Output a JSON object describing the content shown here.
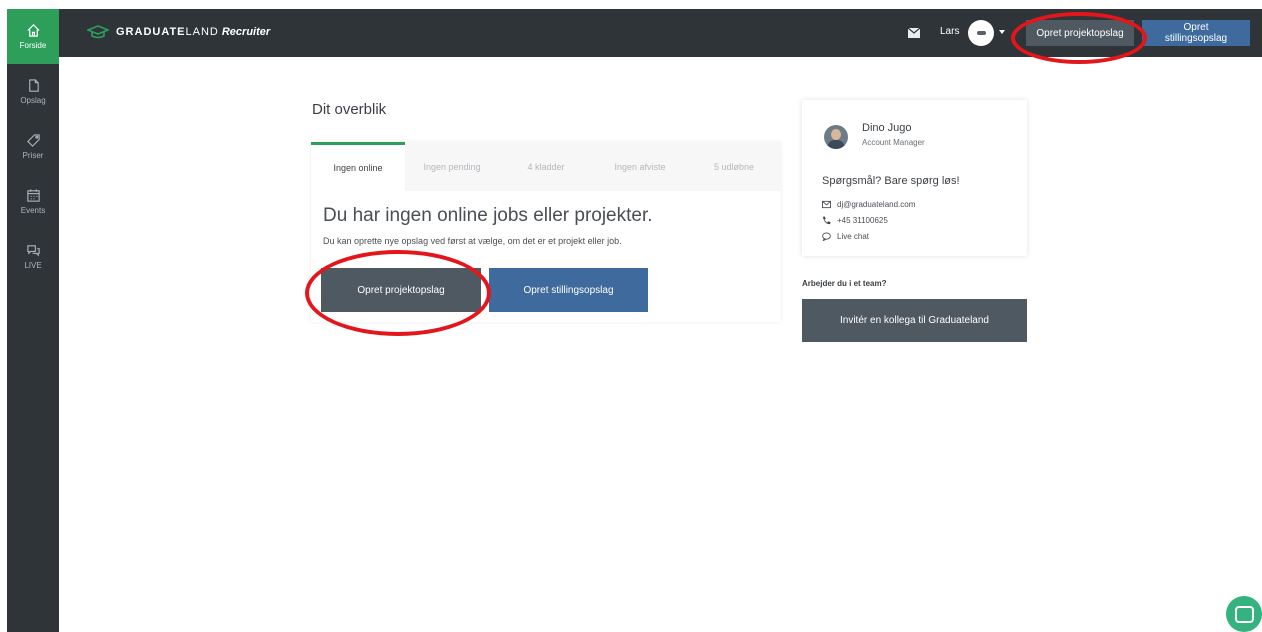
{
  "sidebar": {
    "items": [
      {
        "label": "Forside",
        "icon": "home-icon"
      },
      {
        "label": "Opslag",
        "icon": "document-icon"
      },
      {
        "label": "Priser",
        "icon": "tag-icon"
      },
      {
        "label": "Events",
        "icon": "calendar-icon"
      },
      {
        "label": "LIVE",
        "icon": "chat-bubbles-icon"
      }
    ]
  },
  "header": {
    "brand_bold": "GRADUATE",
    "brand_thin": "LAND",
    "brand_sub": "Recruiter",
    "user_name": "Lars",
    "btn_project": "Opret projektopslag",
    "btn_job": "Opret stillingsopslag"
  },
  "overview": {
    "title": "Dit overblik",
    "tabs": [
      "Ingen online",
      "Ingen pending",
      "4 kladder",
      "Ingen afviste",
      "5 udløbne"
    ],
    "headline": "Du har ingen online jobs eller projekter.",
    "description": "Du kan oprette nye opslag ved først at vælge, om det er et projekt eller job.",
    "btn_project": "Opret projektopslag",
    "btn_job": "Opret stillingsopslag"
  },
  "contact": {
    "name": "Dino Jugo",
    "role": "Account Manager",
    "question": "Spørgsmål? Bare spørg løs!",
    "email": "dj@graduateland.com",
    "phone": "+45 31100625",
    "chat": "Live chat"
  },
  "team": {
    "label": "Arbejder du i et team?",
    "invite": "Invitér en kollega til Graduateland"
  },
  "colors": {
    "accent_green": "#2e9e5b",
    "dark_bar": "#2f3439",
    "blue_button": "#3e6a9d",
    "gray_button": "#4f5961",
    "highlight_red": "#e3161b"
  }
}
